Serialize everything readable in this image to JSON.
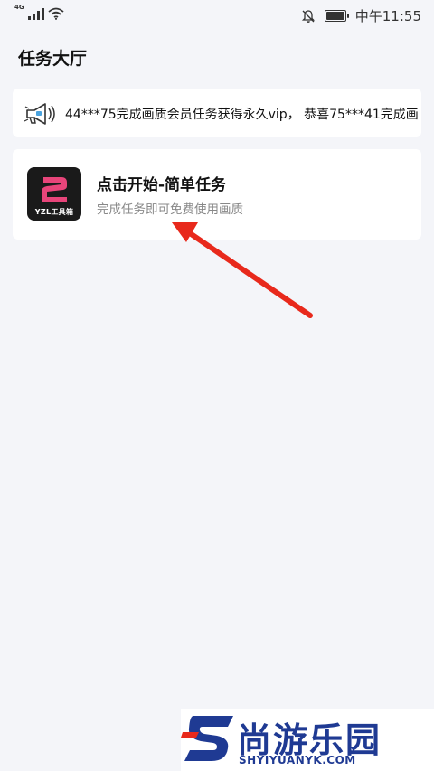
{
  "status_bar": {
    "network": "4G",
    "time": "中午11:55",
    "icons": [
      "signal-icon",
      "wifi-icon",
      "bell-off-icon",
      "battery-icon"
    ]
  },
  "page": {
    "title": "任务大厅"
  },
  "announcement": {
    "icon": "megaphone-icon",
    "text": "44***75完成画质会员任务获得永久vip， 恭喜75***41完成画"
  },
  "task": {
    "logo_text": "YZL工具箱",
    "title": "点击开始-简单任务",
    "subtitle": "完成任务即可免费使用画质"
  },
  "overlay": {
    "arrow": "red-arrow"
  },
  "watermark": {
    "name": "尚游乐园",
    "domain": "SHYIYUANYK.COM"
  },
  "colors": {
    "background": "#f4f5f9",
    "card": "#ffffff",
    "logo_pink": "#e8457a",
    "arrow_red": "#e8291c",
    "watermark_blue": "#1f3a93",
    "watermark_red": "#e8291c"
  }
}
